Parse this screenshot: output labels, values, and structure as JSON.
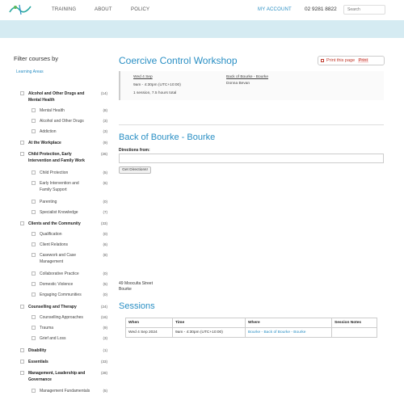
{
  "header": {
    "nav": [
      "TRAINING",
      "ABOUT",
      "POLICY"
    ],
    "account": "MY ACCOUNT",
    "phone": "02 9281 8822",
    "search_placeholder": "Search"
  },
  "sidebar": {
    "title": "Filter courses by",
    "learning_areas": "Learning Areas",
    "items": [
      {
        "label": "Alcohol and Other Drugs and Mental Health",
        "count": "(14)",
        "level": 0
      },
      {
        "label": "Mental Health",
        "count": "(8)",
        "level": 1
      },
      {
        "label": "Alcohol and Other Drugs",
        "count": "(3)",
        "level": 1
      },
      {
        "label": "Addiction",
        "count": "(3)",
        "level": 1
      },
      {
        "label": "At the Workplace",
        "count": "(9)",
        "level": 0
      },
      {
        "label": "Child Protection, Early Intervention and Family Work",
        "count": "(26)",
        "level": 0
      },
      {
        "label": "Child Protection",
        "count": "(5)",
        "level": 1
      },
      {
        "label": "Early Intervention and Family Support",
        "count": "(6)",
        "level": 1
      },
      {
        "label": "Parenting",
        "count": "(0)",
        "level": 1
      },
      {
        "label": "Specialist Knowledge",
        "count": "(7)",
        "level": 1
      },
      {
        "label": "Clients and the Community",
        "count": "(33)",
        "level": 0
      },
      {
        "label": "Qualification",
        "count": "(0)",
        "level": 1
      },
      {
        "label": "Client Relations",
        "count": "(6)",
        "level": 1
      },
      {
        "label": "Casework and Case Management",
        "count": "(8)",
        "level": 1
      },
      {
        "label": "Collaborative Practice",
        "count": "(0)",
        "level": 1
      },
      {
        "label": "Domestic Violence",
        "count": "(5)",
        "level": 1
      },
      {
        "label": "Engaging Communities",
        "count": "(0)",
        "level": 1
      },
      {
        "label": "Counselling and Therapy",
        "count": "(24)",
        "level": 0
      },
      {
        "label": "Counselling Approaches",
        "count": "(16)",
        "level": 1
      },
      {
        "label": "Trauma",
        "count": "(9)",
        "level": 1
      },
      {
        "label": "Grief and Loss",
        "count": "(3)",
        "level": 1
      },
      {
        "label": "Disability",
        "count": "(1)",
        "level": 0
      },
      {
        "label": "Essentials",
        "count": "(33)",
        "level": 0
      },
      {
        "label": "Management, Leadership and Governance",
        "count": "(28)",
        "level": 0
      },
      {
        "label": "Management Fundamentals",
        "count": "(5)",
        "level": 1
      }
    ]
  },
  "course": {
    "title": "Coercive Control Workshop",
    "print_label": "Print this page",
    "print_word": "Print",
    "date": "Wed 4 Sep",
    "time": "9am - 4:30pm (UTC+10:00)",
    "duration": "1 session, 7.5 hours total",
    "venue_link": "Back of Bourke - Bourke",
    "presenter": "Donna Bevan"
  },
  "venue": {
    "title": "Back of Bourke - Bourke",
    "directions_label": "Directions from:",
    "directions_button": "Get Directions!",
    "address_line1": "49 Mooculta Street",
    "address_line2": "Bourke"
  },
  "sessions": {
    "title": "Sessions",
    "headers": [
      "When",
      "Time",
      "Where",
      "Session Notes"
    ],
    "rows": [
      {
        "when": "Wed 4 Sep 2024",
        "time": "9am - 4:30pm (UTC+10:00)",
        "where": "Bourke - Back of Bourke - Bourke",
        "notes": ""
      }
    ]
  },
  "colors": {
    "accent": "#2a8fc4",
    "band": "#d5ebf2",
    "print": "#c0392b"
  }
}
